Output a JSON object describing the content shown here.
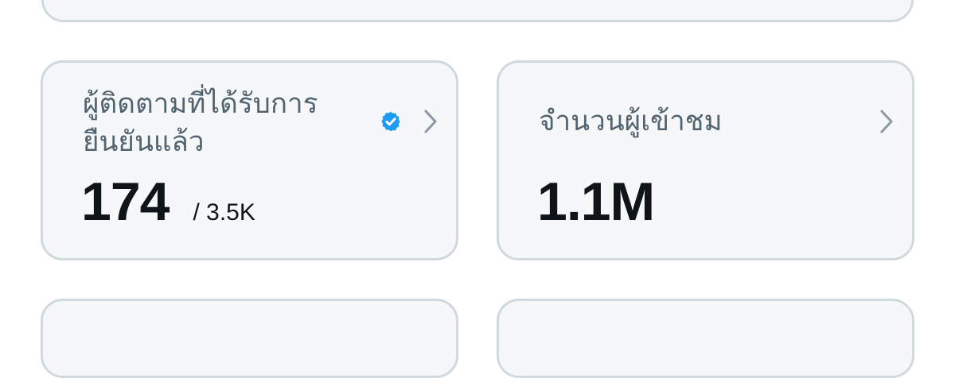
{
  "cards": {
    "verified_followers": {
      "title": "ผู้ติดตามที่ได้รับการยืนยันแล้ว",
      "value": "174",
      "total": "/ 3.5K",
      "badge_icon": "verified-badge-icon",
      "arrow_icon": "chevron-right-icon"
    },
    "impressions": {
      "title": "จำนวนผู้เข้าชม",
      "value": "1.1M",
      "arrow_icon": "chevron-right-icon"
    }
  },
  "colors": {
    "card_background": "#f6f7f8",
    "card_border": "#cfd9de",
    "label_text": "#536471",
    "value_text": "#0f1419",
    "verified_blue": "#1d9bf0",
    "chevron": "#8b98a5"
  }
}
